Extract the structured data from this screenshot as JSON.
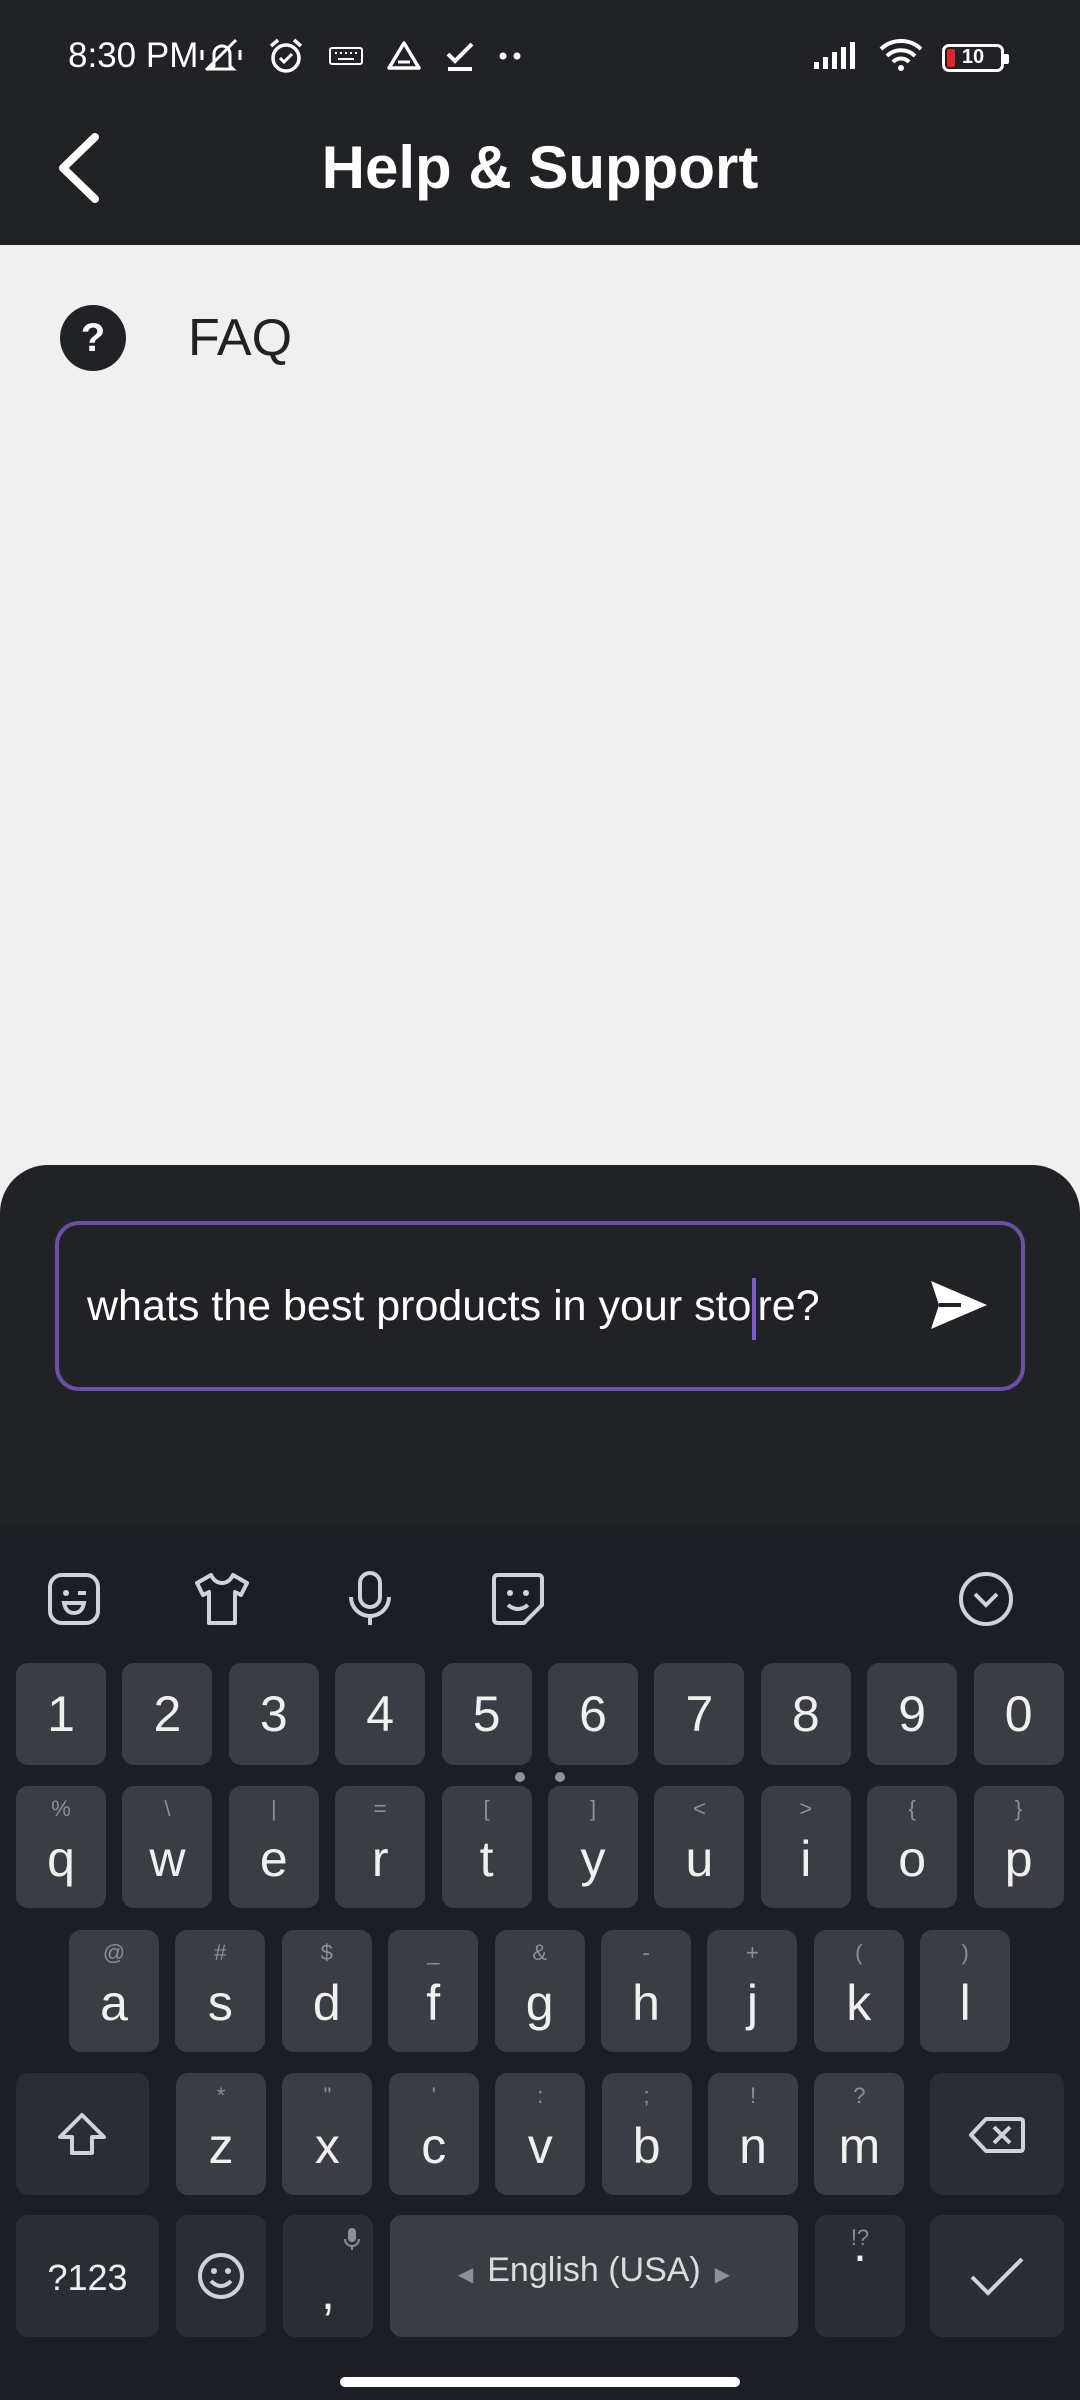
{
  "status_bar": {
    "time": "8:30 PM",
    "battery": "10"
  },
  "header": {
    "title": "Help & Support"
  },
  "faq": {
    "icon_glyph": "?",
    "label": "FAQ"
  },
  "chat": {
    "input_before_caret": "whats the best products in your sto",
    "input_after_caret": "re?"
  },
  "keyboard": {
    "language": "English (USA)",
    "symbols_key": "?123",
    "comma": ",",
    "period": ".",
    "period_hint": "!?",
    "number_row": [
      "1",
      "2",
      "3",
      "4",
      "5",
      "6",
      "7",
      "8",
      "9",
      "0"
    ],
    "row1": [
      {
        "k": "q",
        "h": "%"
      },
      {
        "k": "w",
        "h": "\\"
      },
      {
        "k": "e",
        "h": "|"
      },
      {
        "k": "r",
        "h": "="
      },
      {
        "k": "t",
        "h": "["
      },
      {
        "k": "y",
        "h": "]"
      },
      {
        "k": "u",
        "h": "<"
      },
      {
        "k": "i",
        "h": ">"
      },
      {
        "k": "o",
        "h": "{"
      },
      {
        "k": "p",
        "h": "}"
      }
    ],
    "row2": [
      {
        "k": "a",
        "h": "@"
      },
      {
        "k": "s",
        "h": "#"
      },
      {
        "k": "d",
        "h": "$"
      },
      {
        "k": "f",
        "h": "_"
      },
      {
        "k": "g",
        "h": "&"
      },
      {
        "k": "h",
        "h": "-"
      },
      {
        "k": "j",
        "h": "+"
      },
      {
        "k": "k",
        "h": "("
      },
      {
        "k": "l",
        "h": ")"
      }
    ],
    "row3": [
      {
        "k": "z",
        "h": "*"
      },
      {
        "k": "x",
        "h": "\""
      },
      {
        "k": "c",
        "h": "'"
      },
      {
        "k": "v",
        "h": ":"
      },
      {
        "k": "b",
        "h": ";"
      },
      {
        "k": "n",
        "h": "!"
      },
      {
        "k": "m",
        "h": "?"
      }
    ]
  },
  "colors": {
    "header_bg": "#212226",
    "accent": "#6c4fa6",
    "body_bg": "#f0f0f0",
    "key_bg": "#3a3d43",
    "keyboard_bg": "#1b1e24"
  }
}
